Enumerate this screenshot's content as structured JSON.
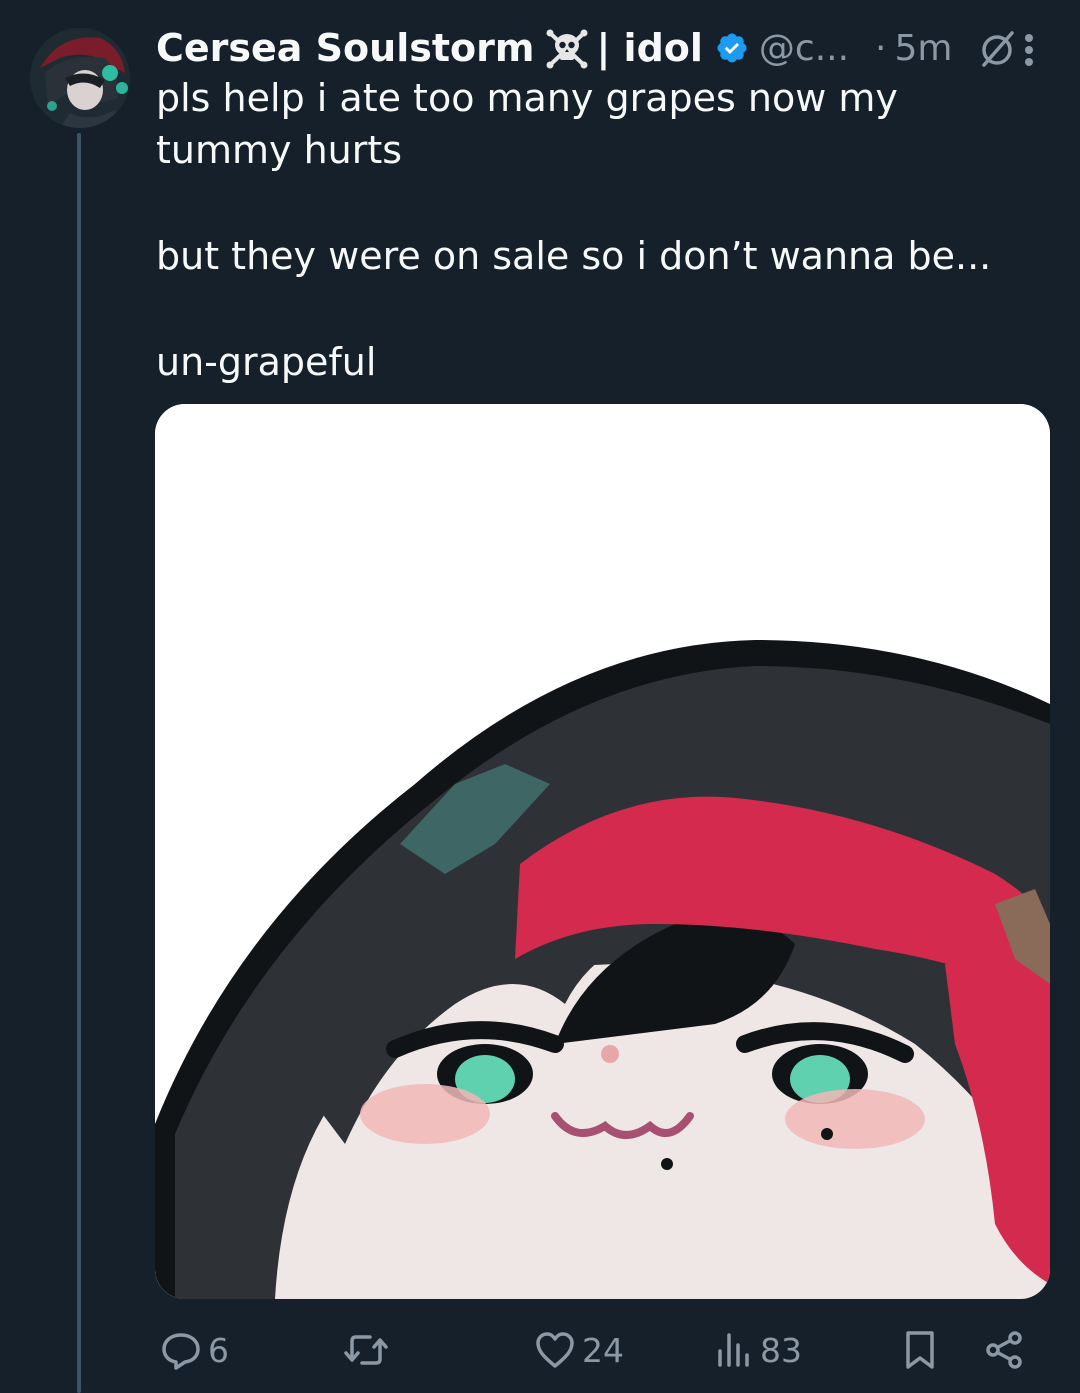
{
  "tweet": {
    "display_name": "Cersea Soulstorm",
    "name_suffix": "| idol",
    "handle": "@c...",
    "separator": "·",
    "time": "5m",
    "text_lines": [
      "pls help i ate too many grapes now my tummy hurts",
      "but they were on sale so i don’t wanna be...",
      "un-grapeful"
    ],
    "media_icon": "emote-image"
  },
  "actions": {
    "replies": "6",
    "retweets": "",
    "likes": "24",
    "views": "83"
  },
  "icons": {
    "verified": "verified-badge-icon",
    "skull": "skull-crossbones-icon",
    "nosign": "circle-slash-icon",
    "more": "more-vertical-icon",
    "reply": "reply-icon",
    "retweet": "retweet-icon",
    "like": "heart-icon",
    "views": "views-chart-icon",
    "bookmark": "bookmark-icon",
    "share": "share-icon"
  },
  "colors": {
    "background": "#15202b",
    "text": "#f7f9f9",
    "muted": "#8b98a5",
    "verified": "#1d9bf0",
    "thread_line": "#3d5466"
  }
}
